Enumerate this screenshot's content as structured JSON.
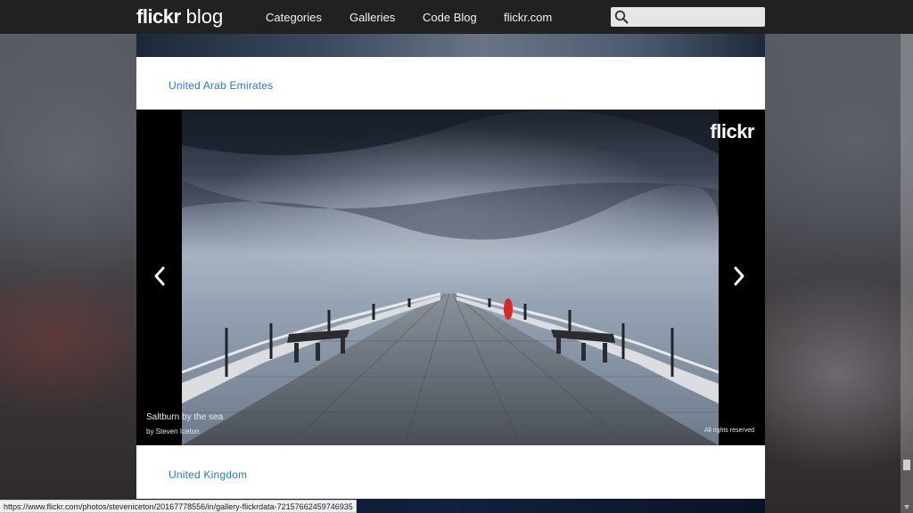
{
  "header": {
    "brand_bold": "flickr",
    "brand_light": "blog",
    "nav": [
      {
        "label": "Categories"
      },
      {
        "label": "Galleries"
      },
      {
        "label": "Code Blog"
      },
      {
        "label": "flickr.com"
      }
    ],
    "search": {
      "placeholder": "",
      "value": ""
    }
  },
  "sections": [
    {
      "country": "United Arab Emirates"
    },
    {
      "country": "United Kingdom"
    }
  ],
  "slideshow": {
    "watermark": "flickr",
    "photo_title": "Saltburn by the sea",
    "photo_author": "by Steven Iceton",
    "rights": "All rights reserved"
  },
  "status_bar": {
    "url": "https://www.flickr.com/photos/steveniceton/20167778556/in/gallery-flickrdata-72157662459746935"
  },
  "colors": {
    "topbar": "#212124",
    "link_blue": "#2a7ab0",
    "content_bg": "#ffffff"
  },
  "icons": {
    "search": "search-icon",
    "prev": "chevron-left-icon",
    "next": "chevron-right-icon"
  }
}
